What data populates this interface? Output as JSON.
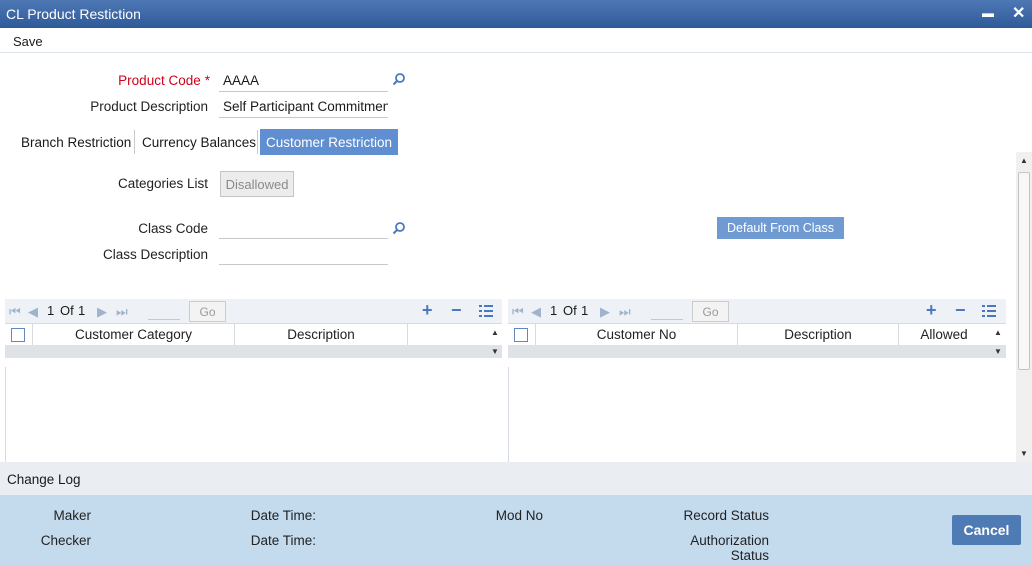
{
  "window": {
    "title": "CL Product Restiction",
    "minimize": "▬",
    "close": "✕"
  },
  "menu": {
    "save": "Save"
  },
  "form": {
    "product_code_label": "Product Code",
    "required_mark": "*",
    "product_code_value": "AAAA",
    "product_description_label": "Product Description",
    "product_description_value": "Self Participant Commitmen"
  },
  "tabs": {
    "branch": "Branch Restriction",
    "currency": "Currency Balances",
    "customer": "Customer Restriction"
  },
  "customer_restriction": {
    "categories_list_label": "Categories List",
    "categories_list_button": "Disallowed",
    "class_code_label": "Class Code",
    "class_code_value": "",
    "class_description_label": "Class Description",
    "class_description_value": "",
    "default_from_class": "Default From Class"
  },
  "grid_left": {
    "page_current": "1",
    "page_of": "Of",
    "page_total": "1",
    "go": "Go",
    "columns": [
      "Customer Category",
      "Description"
    ]
  },
  "grid_right": {
    "page_current": "1",
    "page_of": "Of",
    "page_total": "1",
    "go": "Go",
    "columns": [
      "Customer No",
      "Description",
      "Allowed"
    ]
  },
  "change_log": "Change Log",
  "audit": {
    "maker": "Maker",
    "checker": "Checker",
    "date_time_1": "Date Time:",
    "date_time_2": "Date Time:",
    "mod_no": "Mod No",
    "record_status": "Record Status",
    "authorization_line1": "Authorization",
    "authorization_line2": "Status",
    "cancel": "Cancel"
  }
}
